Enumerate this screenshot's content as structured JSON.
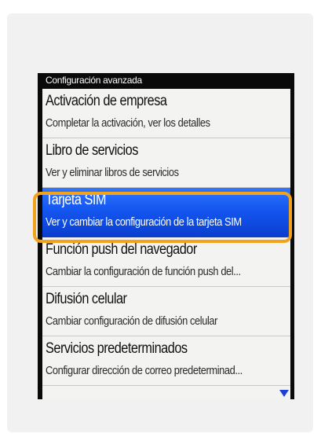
{
  "header": {
    "title": "Configuración avanzada"
  },
  "menu": {
    "items": [
      {
        "title": "Activación de empresa",
        "subtitle": "Completar la activación, ver los detalles"
      },
      {
        "title": "Libro de servicios",
        "subtitle": "Ver y eliminar libros de servicios"
      },
      {
        "title": "Tarjeta SIM",
        "subtitle": "Ver y cambiar la configuración de la tarjeta SIM"
      },
      {
        "title": "Función push del navegador",
        "subtitle": "Cambiar la configuración de función push del..."
      },
      {
        "title": "Difusión celular",
        "subtitle": "Cambiar configuración de difusión celular"
      },
      {
        "title": "Servicios predeterminados",
        "subtitle": "Configurar dirección de correo predeterminad..."
      }
    ],
    "selected_item": "Tarjeta SIM"
  },
  "colors": {
    "selection": "#1456f0",
    "highlight_ring": "#f2a31a"
  },
  "icons": {
    "scroll_indicator": "triangle-down-icon"
  }
}
